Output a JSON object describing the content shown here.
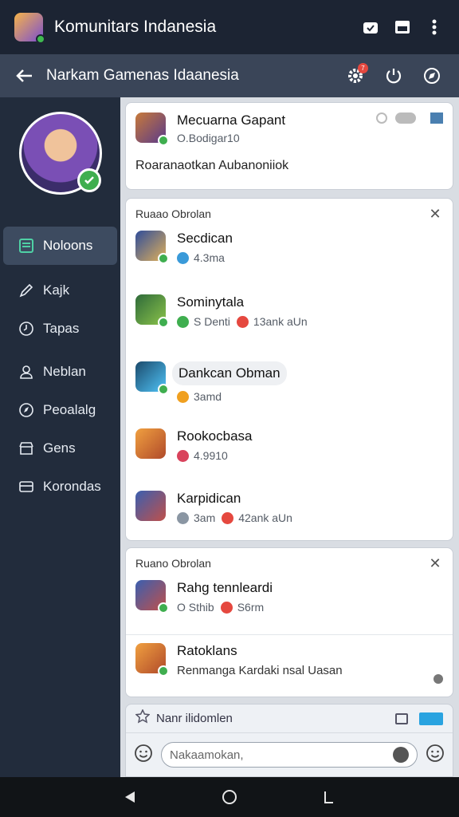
{
  "app": {
    "title": "Komunitars Indanesia"
  },
  "subheader": {
    "title": "Narkam Gamenas Idaanesia",
    "notification_count": "7"
  },
  "sidebar": {
    "items": [
      {
        "label": "Noloons",
        "icon": "list-icon",
        "active": true
      },
      {
        "label": "Kajk",
        "icon": "pencil-icon"
      },
      {
        "label": "Tapas",
        "icon": "clock-icon"
      },
      {
        "label": "Neblan",
        "icon": "person-icon"
      },
      {
        "label": "Peoalalg",
        "icon": "compass-icon"
      },
      {
        "label": "Gens",
        "icon": "store-icon"
      },
      {
        "label": "Korondas",
        "icon": "card-icon"
      }
    ]
  },
  "profile_card": {
    "name": "Mecuarna Gapant",
    "sub": "O.Bodigar10",
    "text": "Roaranaotkan Aubanoniiok"
  },
  "chat_card": {
    "header": "Ruaao Obrolan",
    "items": [
      {
        "name": "Secdican",
        "meta": "4.3ma",
        "dot_color": "#3a9ad9"
      },
      {
        "name": "Sominytala",
        "meta": "S Denti",
        "meta2": "13ank aUn",
        "dot_color": "#3fae4f",
        "dot2_color": "#e5483f"
      },
      {
        "name": "Dankcan Obman",
        "meta": "3amd",
        "dot_color": "#f0a020"
      },
      {
        "name": "Rookocbasa",
        "meta": "4.9910",
        "dot_color": "#d9435c"
      },
      {
        "name": "Karpidican",
        "meta": "3am",
        "meta2": "42ank aUn",
        "dot_color": "#8a96a3",
        "dot2_color": "#e5483f"
      }
    ]
  },
  "room_card": {
    "header": "Ruano Obrolan",
    "items": [
      {
        "name": "Rahg tennleardi",
        "meta": "O Sthib",
        "meta2": "S6rm",
        "dot_color": "#e5483f"
      },
      {
        "name": "Ratoklans",
        "text": "Renmanga Kardaki nsal Uasan"
      }
    ]
  },
  "composer": {
    "title": "Nanr ilidomlen",
    "placeholder": "Nakaamokan,"
  },
  "colors": {
    "accent": "#3a9ad9",
    "success": "#3fae4f",
    "danger": "#e5483f"
  }
}
